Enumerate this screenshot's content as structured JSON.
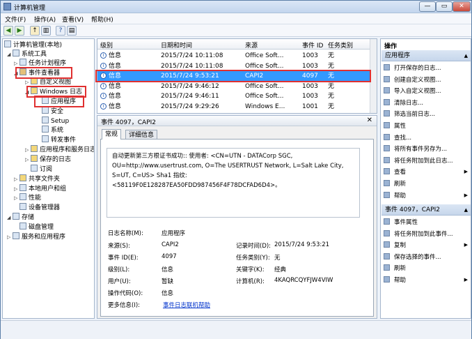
{
  "window": {
    "title": "计算机管理",
    "min": "—",
    "max": "▭",
    "close": "✕"
  },
  "menu": [
    "文件(F)",
    "操作(A)",
    "查看(V)",
    "帮助(H)"
  ],
  "tree": [
    {
      "label": "计算机管理(本地)",
      "exp": "",
      "lvl": 0
    },
    {
      "label": "系统工具",
      "exp": "◢",
      "lvl": 1
    },
    {
      "label": "任务计划程序",
      "exp": "▷",
      "lvl": 2
    },
    {
      "label": "事件查看器",
      "exp": "◢",
      "lvl": 2
    },
    {
      "label": "自定义视图",
      "exp": "▷",
      "lvl": 3
    },
    {
      "label": "Windows 日志",
      "exp": "◢",
      "lvl": 3
    },
    {
      "label": "应用程序",
      "exp": "",
      "lvl": 4
    },
    {
      "label": "安全",
      "exp": "",
      "lvl": 4
    },
    {
      "label": "Setup",
      "exp": "",
      "lvl": 4
    },
    {
      "label": "系统",
      "exp": "",
      "lvl": 4
    },
    {
      "label": "转发事件",
      "exp": "",
      "lvl": 4
    },
    {
      "label": "应用程序和服务日志",
      "exp": "▷",
      "lvl": 3
    },
    {
      "label": "保存的日志",
      "exp": "▷",
      "lvl": 3
    },
    {
      "label": "订阅",
      "exp": "",
      "lvl": 3
    },
    {
      "label": "共享文件夹",
      "exp": "▷",
      "lvl": 2
    },
    {
      "label": "本地用户和组",
      "exp": "▷",
      "lvl": 2
    },
    {
      "label": "性能",
      "exp": "▷",
      "lvl": 2
    },
    {
      "label": "设备管理器",
      "exp": "",
      "lvl": 2
    },
    {
      "label": "存储",
      "exp": "◢",
      "lvl": 1
    },
    {
      "label": "磁盘管理",
      "exp": "",
      "lvl": 2
    },
    {
      "label": "服务和应用程序",
      "exp": "▷",
      "lvl": 1
    }
  ],
  "list": {
    "headers": [
      "级别",
      "日期和时间",
      "来源",
      "事件 ID",
      "任务类别"
    ],
    "rows": [
      [
        "信息",
        "2015/7/24 10:11:08",
        "Office Soft...",
        "1003",
        "无"
      ],
      [
        "信息",
        "2015/7/24 10:11:08",
        "Office Soft...",
        "1003",
        "无"
      ],
      [
        "信息",
        "2015/7/24 9:53:21",
        "CAPI2",
        "4097",
        "无"
      ],
      [
        "信息",
        "2015/7/24 9:46:12",
        "Office Soft...",
        "1003",
        "无"
      ],
      [
        "信息",
        "2015/7/24 9:46:11",
        "Office Soft...",
        "1003",
        "无"
      ],
      [
        "信息",
        "2015/7/24 9:29:26",
        "Windows E...",
        "1001",
        "无"
      ]
    ],
    "selected": 2
  },
  "detail": {
    "header": "事件 4097，CAPI2",
    "tabs": [
      "常规",
      "详细信息"
    ],
    "message": "自动更新第三方根证书成功:: 使用者: <CN=UTN - DATACorp SGC, OU=http://www.usertrust.com, O=The USERTRUST Network, L=Salt Lake City, S=UT, C=US> Sha1 指纹: <58119F0E128287EA50FDD987456F4F78DCFAD6D4>。",
    "fields": {
      "log_name_l": "日志名称(M):",
      "log_name": "应用程序",
      "source_l": "来源(S):",
      "source": "CAPI2",
      "logged_l": "记录时间(D):",
      "logged": "2015/7/24 9:53:21",
      "eventid_l": "事件 ID(E):",
      "eventid": "4097",
      "task_l": "任务类别(Y):",
      "task": "无",
      "level_l": "级别(L):",
      "level": "信息",
      "keywords_l": "关键字(K):",
      "keywords": "经典",
      "user_l": "用户(U):",
      "user": "暂缺",
      "computer_l": "计算机(R):",
      "computer": "4KAQRCQYFJW4VIW",
      "opcode_l": "操作代码(O):",
      "opcode": "信息",
      "more_l": "更多信息(I):",
      "more": "事件日志联机帮助"
    }
  },
  "actions": {
    "title": "操作",
    "sec1": "应用程序",
    "items1": [
      "打开保存的日志...",
      "创建自定义视图...",
      "导入自定义视图...",
      "清除日志...",
      "筛选当前日志...",
      "属性",
      "查找...",
      "将所有事件另存为...",
      "将任务附加到此日志...",
      "查看",
      "刷新",
      "帮助"
    ],
    "sec2": "事件 4097，CAPI2",
    "items2": [
      "事件属性",
      "将任务附加到此事件...",
      "复制",
      "保存选择的事件...",
      "刷新",
      "帮助"
    ]
  },
  "colors": {
    "selection": "#3399ff",
    "highlight_box": "#e03030",
    "link": "#0033cc"
  }
}
